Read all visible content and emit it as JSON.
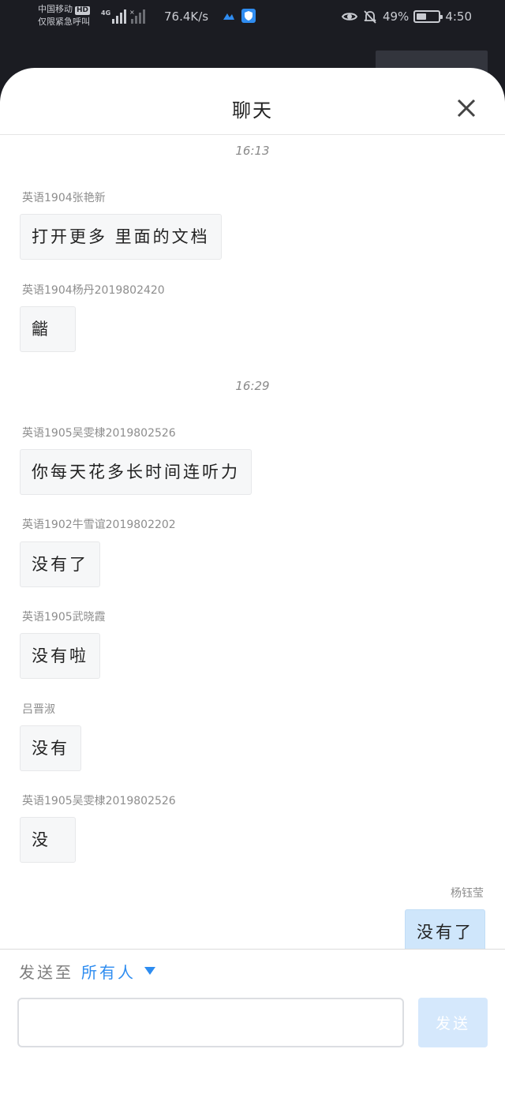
{
  "status_bar": {
    "carrier_line1": "中国移动",
    "hd_badge": "HD",
    "carrier_line2": "仅限紧急呼叫",
    "net_type": "4G",
    "speed": "76.4K/s",
    "battery_text": "49%",
    "battery_level_percent": 45,
    "time": "4:50"
  },
  "chat": {
    "title": "聊天",
    "messages": [
      {
        "time": "16:13"
      },
      {
        "sender": "英语1904张艳新",
        "text": "打开更多 里面的文档"
      },
      {
        "sender": "英语1904杨丹2019802420",
        "text": "龤"
      },
      {
        "time": "16:29"
      },
      {
        "sender": "英语1905吴雯棣2019802526",
        "text": "你每天花多长时间连听力"
      },
      {
        "sender": "英语1902牛雪谊2019802202",
        "text": "没有了"
      },
      {
        "sender": "英语1905武晓霞",
        "text": "没有啦"
      },
      {
        "sender": "吕晋淑",
        "text": "没有"
      },
      {
        "sender": "英语1905吴雯棣2019802526",
        "text": "没"
      },
      {
        "sender": "杨钰莹",
        "text": "没有了",
        "self": true
      }
    ]
  },
  "composer": {
    "send_to_label": "发送至",
    "send_to_value": "所有人",
    "input_value": "",
    "input_placeholder": "",
    "send_label": "发送"
  },
  "colors": {
    "accent": "#2d8cf0",
    "self_bubble": "#cfe6fb",
    "other_bubble": "#f6f7f8",
    "send_button": "#d5e8fc"
  }
}
